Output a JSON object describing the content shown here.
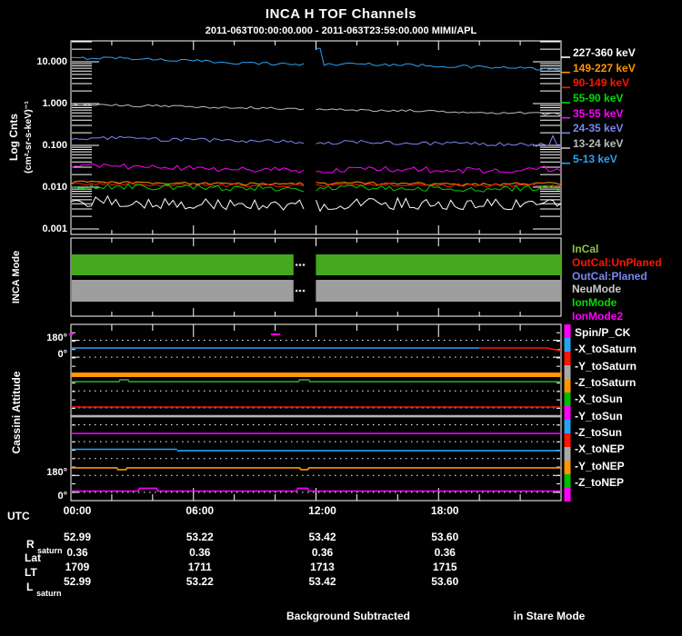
{
  "title": "INCA H TOF Channels",
  "subtitle": "2011-063T00:00:00.000 - 2011-063T23:59:00.000 MIMI/APL",
  "footer": {
    "background_note": "Background Subtracted",
    "mode_note": "in Stare Mode"
  },
  "top_panel": {
    "ylabel": "Log Cnts",
    "ylabel_units": "(cm²-sr-s-keV)⁻¹",
    "ytick_labels": [
      "10.000",
      "1.000",
      "0.100",
      "0.010",
      "0.001"
    ],
    "legend": [
      {
        "label": "227-360 keV",
        "color": "#FFFFFF"
      },
      {
        "label": "149-227 keV",
        "color": "#FF9500"
      },
      {
        "label": "90-149 keV",
        "color": "#FF1500"
      },
      {
        "label": "55-90 keV",
        "color": "#00DD00"
      },
      {
        "label": "35-55 keV",
        "color": "#FF00FF"
      },
      {
        "label": "24-35 keV",
        "color": "#7B86F0"
      },
      {
        "label": "13-24 keV",
        "color": "#BBBBBB"
      },
      {
        "label": "5-13 keV",
        "color": "#2AA2F2"
      }
    ]
  },
  "mode_panel": {
    "ylabel": "INCA Mode",
    "legend": [
      {
        "label": "InCal",
        "color": "#8CC63F"
      },
      {
        "label": "OutCal:UnPlaned",
        "color": "#FF1500"
      },
      {
        "label": "OutCal:Planed",
        "color": "#7B86F0"
      },
      {
        "label": "NeuMode",
        "color": "#CCCCCC"
      },
      {
        "label": "IonMode",
        "color": "#00DD00"
      },
      {
        "label": "IonMode2",
        "color": "#FF00FF"
      }
    ]
  },
  "attitude_panel": {
    "ylabel": "Cassini Attitude",
    "ytick_labels": [
      "180°",
      "0°",
      "180°",
      "0°"
    ],
    "legend": [
      "Spin/P_CK",
      "-X_toSaturn",
      "-Y_toSaturn",
      "-Z_toSaturn",
      "-X_toSun",
      "-Y_toSun",
      "-Z_toSun",
      "-X_toNEP",
      "-Y_toNEP",
      "-Z_toNEP"
    ],
    "swatch_cycle": [
      "#FF00FF",
      "#2AA2F2",
      "#FF1500",
      "#A8A8A8",
      "#FF9500",
      "#00BB00"
    ]
  },
  "xaxis": {
    "label": "UTC",
    "tick_labels": [
      "00:00",
      "06:00",
      "12:00",
      "18:00"
    ]
  },
  "ephemeris": {
    "rows": [
      {
        "label": "R",
        "subscript": "saturn",
        "values": [
          "52.99",
          "53.22",
          "53.42",
          "53.60"
        ]
      },
      {
        "label": "Lat",
        "subscript": "",
        "values": [
          "0.36",
          "0.36",
          "0.36",
          "0.36"
        ]
      },
      {
        "label": "LT",
        "subscript": "",
        "values": [
          "1709",
          "1711",
          "1713",
          "1715"
        ]
      },
      {
        "label": "L",
        "subscript": "saturn",
        "values": [
          "52.99",
          "53.22",
          "53.42",
          "53.60"
        ]
      }
    ]
  },
  "chart_data": [
    {
      "type": "line",
      "panel": "flux",
      "title": "INCA H TOF Channels",
      "xlabel": "UTC (hours, 2011-063)",
      "ylabel": "Log Cnts (cm²-sr-s-keV)⁻¹",
      "y_scale": "log",
      "ylim": [
        0.001,
        31.6
      ],
      "x_range_hours": [
        0,
        24
      ],
      "data_gap_hours": [
        11.45,
        11.95
      ],
      "x_hours": [
        0,
        2,
        4,
        6,
        8,
        10,
        12,
        14,
        16,
        18,
        20,
        22,
        24
      ],
      "series": [
        {
          "name": "5-13 keV",
          "color": "#2AA2F2",
          "values": [
            12,
            12.5,
            11.5,
            10.5,
            9.5,
            9,
            8.5,
            9,
            8.5,
            8,
            7.5,
            7,
            6.5
          ],
          "noise_log10": 0.035,
          "spike": {
            "hour": 12.1,
            "value": 21
          }
        },
        {
          "name": "13-24 keV",
          "color": "#BBBBBB",
          "values": [
            0.95,
            0.9,
            0.88,
            0.85,
            0.8,
            0.78,
            0.72,
            0.7,
            0.68,
            0.66,
            0.62,
            0.6,
            0.55
          ],
          "noise_log10": 0.03
        },
        {
          "name": "24-35 keV",
          "color": "#7B86F0",
          "values": [
            0.14,
            0.15,
            0.14,
            0.135,
            0.13,
            0.125,
            0.115,
            0.12,
            0.115,
            0.11,
            0.11,
            0.105,
            0.1
          ],
          "noise_log10": 0.045,
          "spike": {
            "hour": 23.6,
            "value": 0.17
          }
        },
        {
          "name": "35-55 keV",
          "color": "#FF00FF",
          "values": [
            0.03,
            0.032,
            0.03,
            0.028,
            0.027,
            0.026,
            0.024,
            0.027,
            0.027,
            0.026,
            0.025,
            0.026,
            0.028
          ],
          "noise_log10": 0.07
        },
        {
          "name": "149-227 keV",
          "color": "#FF9500",
          "values": [
            0.013,
            0.013,
            0.0125,
            0.0125,
            0.012,
            0.012,
            0.012,
            0.0125,
            0.012,
            0.012,
            0.0115,
            0.012,
            0.012
          ],
          "noise_log10": 0.035
        },
        {
          "name": "90-149 keV",
          "color": "#FF1500",
          "values": [
            0.012,
            0.012,
            0.0115,
            0.0115,
            0.011,
            0.011,
            0.011,
            0.0115,
            0.0115,
            0.011,
            0.011,
            0.011,
            0.011
          ],
          "noise_log10": 0.04
        },
        {
          "name": "55-90 keV",
          "color": "#00CC00",
          "values": [
            0.01,
            0.0105,
            0.01,
            0.01,
            0.0095,
            0.0095,
            0.009,
            0.01,
            0.0095,
            0.0095,
            0.009,
            0.0095,
            0.0095
          ],
          "noise_log10": 0.07
        },
        {
          "name": "227-360 keV",
          "color": "#FFFFFF",
          "values": [
            0.004,
            0.0045,
            0.0042,
            0.004,
            0.0038,
            0.004,
            0.0036,
            0.0042,
            0.004,
            0.0038,
            0.004,
            0.0038,
            0.004
          ],
          "noise_log10": 0.14
        }
      ]
    },
    {
      "type": "interval",
      "panel": "mode",
      "bars": [
        {
          "color": "#45A81E",
          "active_hours": [
            [
              0,
              10.9
            ],
            [
              11.95,
              24
            ]
          ],
          "gap_dot_hours": [
            11.05,
            11.22,
            11.4
          ]
        },
        {
          "color": "#9E9E9E",
          "active_hours": [
            [
              0,
              10.9
            ],
            [
              11.95,
              24
            ]
          ],
          "gap_dot_hours": [
            11.05,
            11.22,
            11.4
          ]
        }
      ]
    },
    {
      "type": "line",
      "panel": "attitude",
      "y_axis": "stacked 0-180 degree sub-scales, 180° at top and 0° at bottom of each",
      "lines": [
        {
          "color": "#FF00FF",
          "width": 2,
          "segs": [
            [
              -0.1,
              0.1,
              0.057
            ],
            [
              9.8,
              10.25,
              0.057
            ]
          ]
        },
        {
          "color": "#2AA2F2",
          "width": 1.6,
          "segs": [
            [
              0,
              20,
              0.134
            ]
          ]
        },
        {
          "color": "#FF1500",
          "width": 1.6,
          "segs": [
            [
              20,
              23.3,
              0.134
            ],
            [
              23.3,
              24,
              0.134,
              0.15
            ]
          ]
        },
        {
          "color": "#FF9500",
          "width": 5,
          "segs": [
            [
              0,
              24,
              0.286
            ]
          ]
        },
        {
          "color": "#2FA32F",
          "width": 1.6,
          "segs": [
            [
              0,
              24,
              0.325
            ]
          ],
          "bumps": [
            [
              2.35,
              2.8,
              -0.01
            ],
            [
              11.2,
              11.7,
              -0.01
            ]
          ]
        },
        {
          "color": "#FF1500",
          "width": 1.6,
          "segs": [
            [
              0,
              24,
              0.469
            ]
          ]
        },
        {
          "color": "#B4B4B4",
          "width": 2.6,
          "segs": [
            [
              0,
              24,
              0.521
            ]
          ]
        },
        {
          "color": "#EE00EE",
          "width": 1.6,
          "segs": [
            [
              0,
              24,
              0.619
            ]
          ]
        },
        {
          "color": "#2AA2F2",
          "width": 1.6,
          "segs": [
            [
              0,
              5.2,
              0.709
            ],
            [
              5.2,
              24,
              0.717
            ]
          ]
        },
        {
          "color": "#FF9500",
          "width": 1.6,
          "segs": [
            [
              0,
              24,
              0.814
            ]
          ],
          "bumps": [
            [
              2.3,
              2.72,
              0.01
            ],
            [
              11.25,
              11.65,
              0.01
            ]
          ]
        },
        {
          "color": "#FF00FF",
          "width": 1.6,
          "segs": [
            [
              0,
              24,
              0.946
            ]
          ],
          "bumps": [
            [
              3.34,
              4.23,
              -0.016
            ],
            [
              11.1,
              11.65,
              -0.016
            ]
          ]
        }
      ]
    }
  ]
}
